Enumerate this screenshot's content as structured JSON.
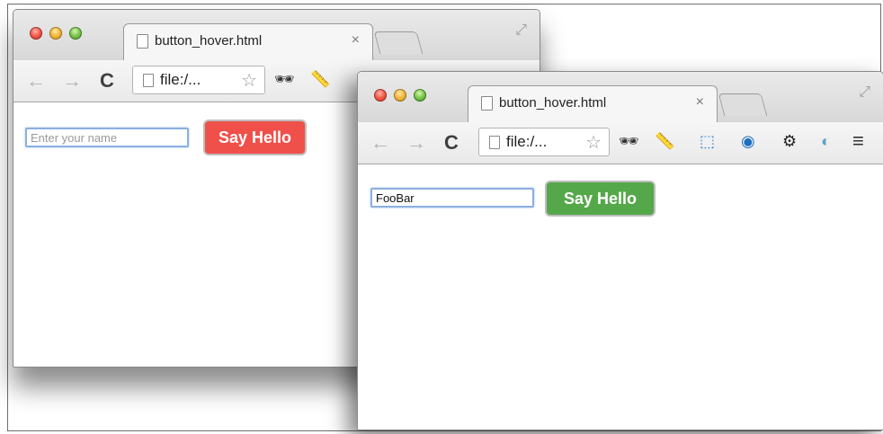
{
  "windows": [
    {
      "tab": {
        "title": "button_hover.html",
        "close": "×"
      },
      "toolbar": {
        "back": "←",
        "forward": "→",
        "reload": "C",
        "address": "file:/...",
        "star": "☆"
      },
      "input": {
        "value": "",
        "placeholder": "Enter your name"
      },
      "button": {
        "label": "Say Hello",
        "color": "#f0504a",
        "state": "default"
      }
    },
    {
      "tab": {
        "title": "button_hover.html",
        "close": "×"
      },
      "toolbar": {
        "back": "←",
        "forward": "→",
        "reload": "C",
        "address": "file:/...",
        "star": "☆"
      },
      "input": {
        "value": "FooBar",
        "placeholder": ""
      },
      "button": {
        "label": "Say Hello",
        "color": "#55a84a",
        "state": "hover"
      }
    }
  ],
  "icons": {
    "resize": "⤢",
    "incognito": "🕶",
    "ruler": "📏",
    "screen": "⬚",
    "eye": "◉",
    "gear": "⚙",
    "ext": "◐",
    "menu": "≡"
  }
}
